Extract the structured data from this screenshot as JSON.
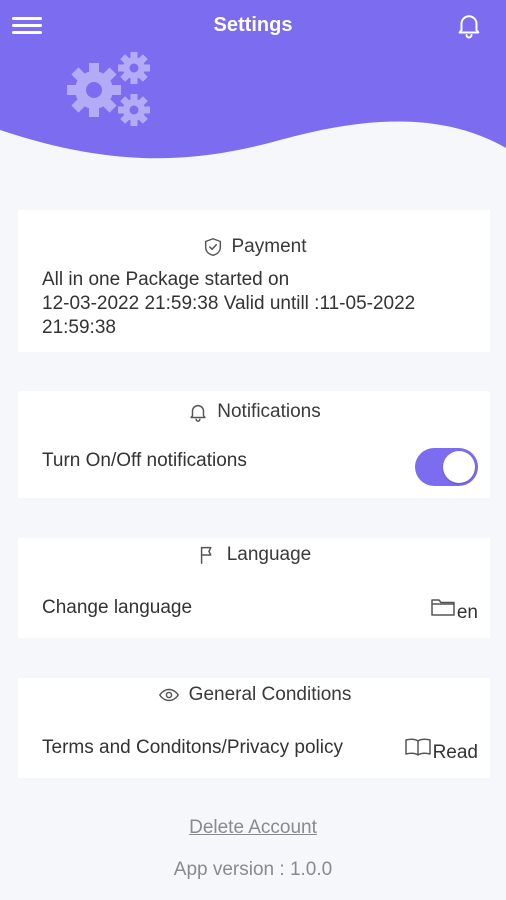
{
  "colors": {
    "header_bg": "#7b6cf0",
    "gears": "#b3abf6",
    "toggle_on": "#7b6cf0",
    "page_bg": "#f6f7fb",
    "card_bg": "#ffffff"
  },
  "header": {
    "title": "Settings",
    "menu_icon": "hamburger-menu-icon",
    "bell_icon": "bell-icon",
    "illustration": "gears-icon"
  },
  "payment": {
    "icon": "shield-check-icon",
    "title": "Payment",
    "line1": "All in one Package started on",
    "line2": "12-03-2022 21:59:38 Valid untill :11-05-2022",
    "line3": "21:59:38"
  },
  "notifications": {
    "icon": "bell-icon",
    "title": "Notifications",
    "label": "Turn On/Off notifications",
    "enabled": true
  },
  "language": {
    "icon": "flag-icon",
    "title": "Language",
    "label": "Change language",
    "action_icon": "folder-icon",
    "value": "en"
  },
  "conditions": {
    "icon": "eye-icon",
    "title": "General Conditions",
    "label": "Terms and Conditons/Privacy policy",
    "action_icon": "book-icon",
    "action_label": "Read"
  },
  "footer": {
    "delete_label": "Delete Account",
    "version_text": "App version : 1.0.0"
  }
}
